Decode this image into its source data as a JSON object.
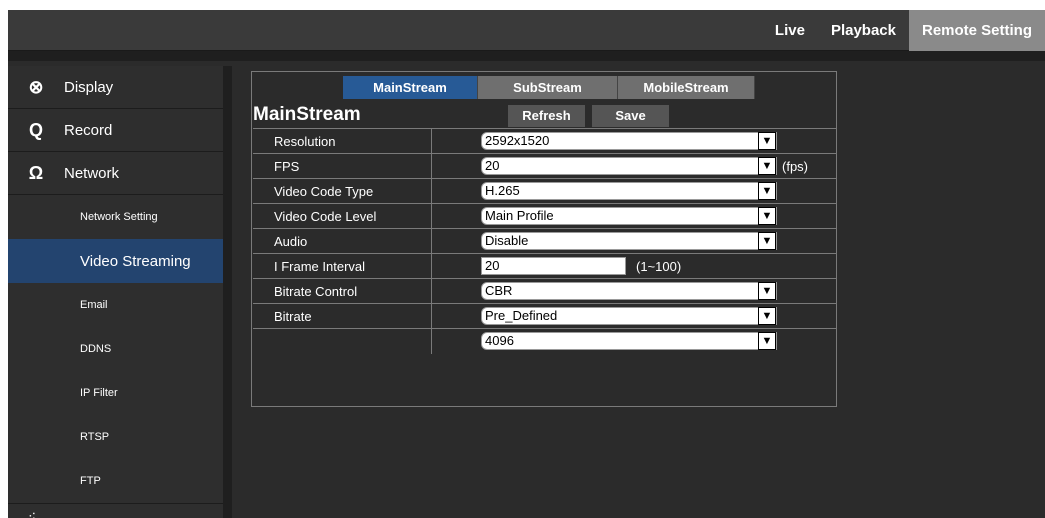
{
  "topnav": [
    {
      "label": "Live",
      "active": false
    },
    {
      "label": "Playback",
      "active": false
    },
    {
      "label": "Remote Setting",
      "active": true
    }
  ],
  "sidebar": {
    "main": [
      {
        "label": "Display",
        "icon": "⊗"
      },
      {
        "label": "Record",
        "icon": "Q"
      },
      {
        "label": "Network",
        "icon": "Ω"
      }
    ],
    "sub": [
      {
        "label": "Network Setting"
      },
      {
        "label": "Video Streaming",
        "active": true
      },
      {
        "label": "Email"
      },
      {
        "label": "DDNS"
      },
      {
        "label": "IP Filter"
      },
      {
        "label": "RTSP"
      },
      {
        "label": "FTP"
      }
    ],
    "bottom_icon": "⁖"
  },
  "tabs": [
    {
      "label": "MainStream",
      "active": true
    },
    {
      "label": "SubStream"
    },
    {
      "label": "MobileStream"
    }
  ],
  "section": {
    "title": "MainStream",
    "refresh_label": "Refresh",
    "save_label": "Save"
  },
  "fields": {
    "resolution": {
      "label": "Resolution",
      "value": "2592x1520"
    },
    "fps": {
      "label": "FPS",
      "value": "20",
      "unit": "(fps)"
    },
    "video_code_type": {
      "label": "Video Code Type",
      "value": "H.265"
    },
    "video_code_level": {
      "label": "Video Code Level",
      "value": "Main Profile"
    },
    "audio": {
      "label": "Audio",
      "value": "Disable"
    },
    "i_frame_interval": {
      "label": "I Frame Interval",
      "value": "20",
      "range": "(1~100)"
    },
    "bitrate_control": {
      "label": "Bitrate Control",
      "value": "CBR"
    },
    "bitrate": {
      "label": "Bitrate",
      "value": "Pre_Defined"
    },
    "bitrate_value": {
      "label": "",
      "value": "4096"
    }
  },
  "colors": {
    "accent": "#275a96",
    "sidebar_active": "#23446f",
    "background": "#2b2b2b"
  }
}
